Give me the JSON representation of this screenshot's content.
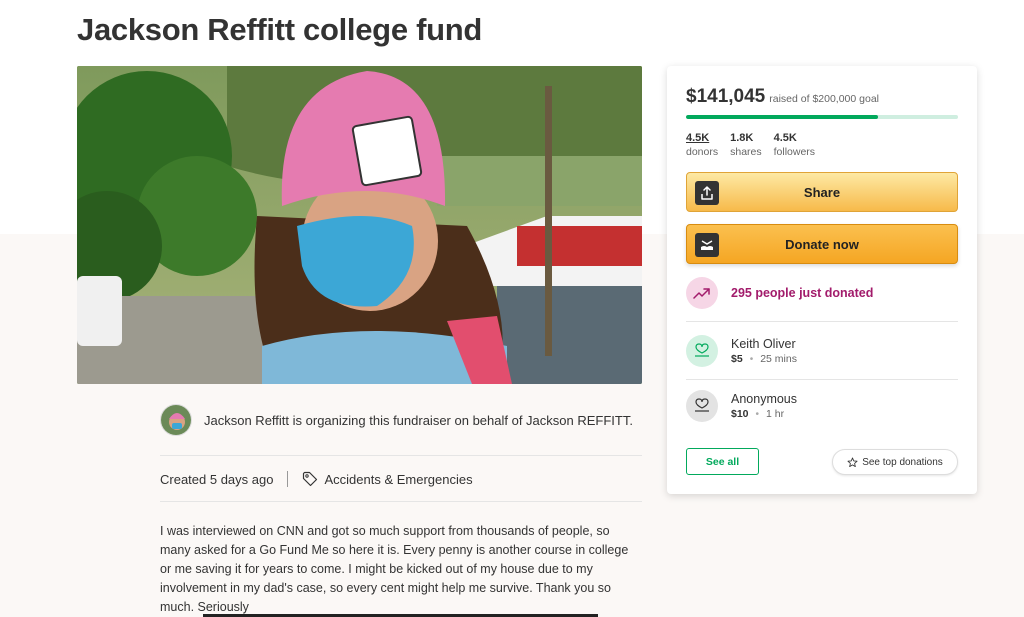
{
  "page_title": "Jackson Reffitt college fund",
  "organizer": {
    "text": "Jackson Reffitt is organizing this fundraiser on behalf of Jackson REFFITT."
  },
  "meta": {
    "created": "Created 5 days ago",
    "category": "Accidents & Emergencies"
  },
  "story": "I was interviewed on CNN and got so much support from thousands of people, so many asked for a Go Fund Me so here it is. Every penny is another course in college or me saving it for years to come. I might be kicked out of my house due to my involvement in my dad's case, so every cent might help me survive. Thank you so much. Seriously",
  "donation_card": {
    "raised": "$141,045",
    "goal_text": "raised of $200,000 goal",
    "progress_fraction": 0.705,
    "stats": [
      {
        "value": "4.5K",
        "label": "donors"
      },
      {
        "value": "1.8K",
        "label": "shares"
      },
      {
        "value": "4.5K",
        "label": "followers"
      }
    ],
    "share_label": "Share",
    "donate_label": "Donate now",
    "trending_text": "295 people just donated",
    "recent_donors": [
      {
        "name": "Keith Oliver",
        "amount": "$5",
        "time": "25 mins"
      },
      {
        "name": "Anonymous",
        "amount": "$10",
        "time": "1 hr"
      }
    ],
    "see_all_label": "See all",
    "see_top_label": "See top donations"
  },
  "colors": {
    "accent_green": "#02a95c",
    "donate_orange": "#f5a623",
    "trend_magenta": "#a21b6b"
  },
  "icons": [
    "upload-icon",
    "donate-hand-icon",
    "trending-up-icon",
    "donor-heart-icon",
    "tag-icon",
    "star-icon"
  ]
}
